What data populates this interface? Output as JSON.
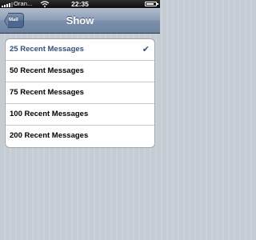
{
  "status_bar": {
    "carrier": "Oran...",
    "time": "22:35",
    "battery_level": 0.85
  },
  "nav": {
    "title": "Show",
    "back_label": "Mail"
  },
  "options": [
    {
      "label": "25 Recent Messages",
      "selected": true
    },
    {
      "label": "50 Recent Messages",
      "selected": false
    },
    {
      "label": "75 Recent Messages",
      "selected": false
    },
    {
      "label": "100 Recent Messages",
      "selected": false
    },
    {
      "label": "200 Recent Messages",
      "selected": false
    }
  ],
  "colors": {
    "selected_text": "#324f85",
    "nav_bar": "#7b90ac",
    "background": "#c5ccd4"
  },
  "icons": {
    "checkmark": "checkmark-icon",
    "signal": "signal-strength-icon",
    "wifi": "wifi-icon",
    "battery": "battery-icon"
  }
}
